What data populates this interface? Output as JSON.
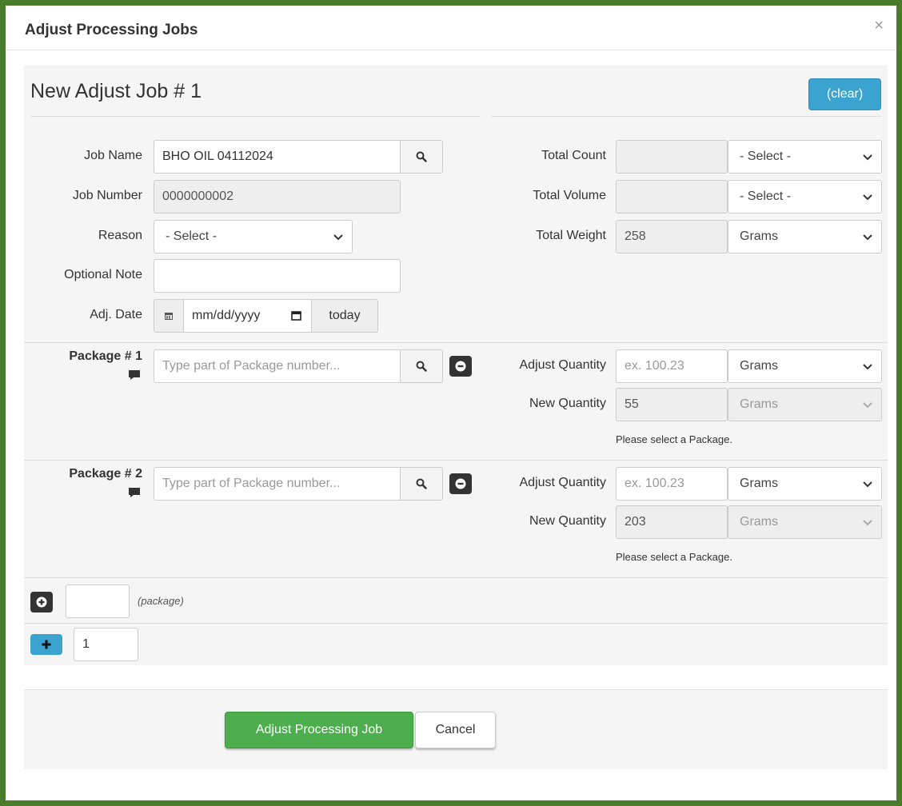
{
  "modal": {
    "title": "Adjust Processing Jobs",
    "close": "×"
  },
  "job": {
    "title": "New Adjust Job # 1",
    "clear_label": "(clear)"
  },
  "form": {
    "job_name_label": "Job Name",
    "job_name_value": "BHO OIL 04112024",
    "job_number_label": "Job Number",
    "job_number_value": "0000000002",
    "reason_label": "Reason",
    "reason_value": "- Select -",
    "note_label": "Optional Note",
    "note_value": "",
    "date_label": "Adj. Date",
    "date_placeholder": "mm/dd/yyyy",
    "today_label": "today",
    "total_count_label": "Total Count",
    "total_count_value": "",
    "total_count_unit": "- Select -",
    "total_volume_label": "Total Volume",
    "total_volume_value": "",
    "total_volume_unit": "- Select -",
    "total_weight_label": "Total Weight",
    "total_weight_value": "258",
    "total_weight_unit": "Grams"
  },
  "packages": [
    {
      "label": "Package # 1",
      "placeholder": "Type part of Package number...",
      "adjust_label": "Adjust Quantity",
      "adjust_placeholder": "ex. 100.23",
      "adjust_unit": "Grams",
      "new_label": "New Quantity",
      "new_value": "55",
      "new_unit": "Grams",
      "hint": "Please select a Package."
    },
    {
      "label": "Package # 2",
      "placeholder": "Type part of Package number...",
      "adjust_label": "Adjust Quantity",
      "adjust_placeholder": "ex. 100.23",
      "adjust_unit": "Grams",
      "new_label": "New Quantity",
      "new_value": "203",
      "new_unit": "Grams",
      "hint": "Please select a Package."
    }
  ],
  "add_package": {
    "hint": "(package)",
    "count_value": "",
    "job_count_value": "1"
  },
  "footer": {
    "primary_label": "Adjust Processing Job",
    "cancel_label": "Cancel"
  },
  "colors": {
    "frame": "#4a7c2c",
    "info": "#3aa3cf",
    "success": "#4cae4c"
  }
}
